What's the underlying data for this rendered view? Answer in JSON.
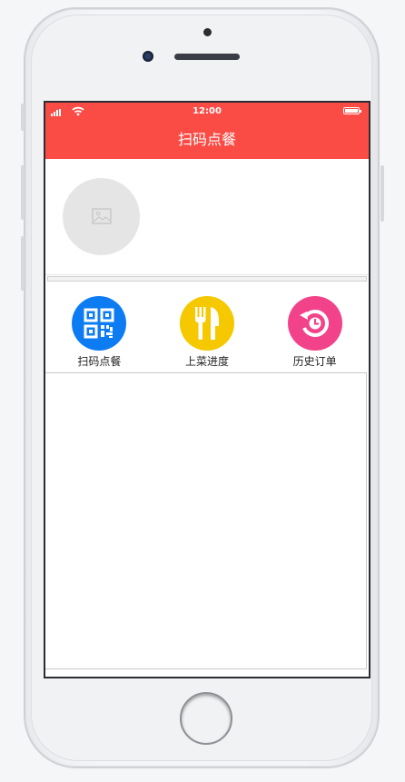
{
  "status_bar": {
    "time": "12:00"
  },
  "nav": {
    "title": "扫码点餐"
  },
  "menu": [
    {
      "label": "扫码点餐",
      "icon": "qr-code-icon",
      "color": "#0d7cf2"
    },
    {
      "label": "上菜进度",
      "icon": "fork-knife-icon",
      "color": "#f5c800"
    },
    {
      "label": "历史订单",
      "icon": "history-clock-icon",
      "color": "#f2438a"
    }
  ],
  "colors": {
    "brand": "#fb4b45"
  }
}
